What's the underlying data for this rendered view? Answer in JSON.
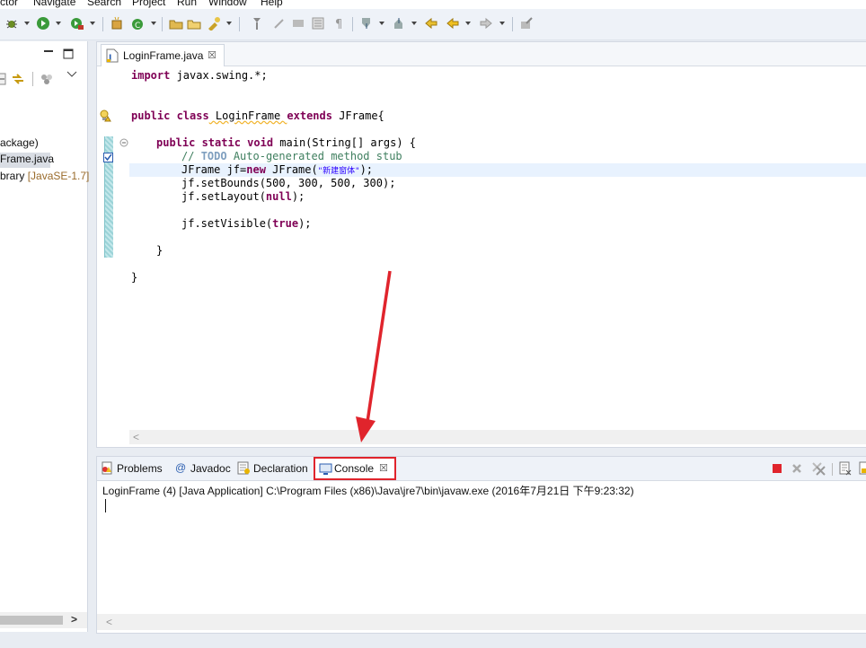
{
  "menu": {
    "items": [
      "ctor",
      "Navigate",
      "Search",
      "Project",
      "Run",
      "Window",
      "Help"
    ]
  },
  "toolbar": {
    "icons": [
      "debug-icon",
      "run-icon",
      "external-tools-icon",
      "new-java-package-icon",
      "new-java-class-icon",
      "open-type-icon",
      "open-task-icon",
      "search-icon",
      "toggle-mark-occurrences-icon",
      "show-whitespace-icon",
      "toggle-block-selection-icon",
      "next-annotation-icon",
      "previous-annotation-icon",
      "last-edit-location-icon",
      "back-icon",
      "forward-icon",
      "pin-editor-icon"
    ]
  },
  "explorer": {
    "items": [
      {
        "label": "ackage)"
      },
      {
        "label": "Frame.java"
      },
      {
        "label": "brary ",
        "decoration": "[JavaSE-1.7]"
      }
    ]
  },
  "editor": {
    "tab_label": "LoginFrame.java",
    "close_glyph": "☒",
    "code": {
      "l1_kw": "import",
      "l1_rest": " javax.swing.*;",
      "l2_kw": "public class",
      "l2_name": " LoginFrame ",
      "l2_kw2": "extends",
      "l2_rest": " JFrame{",
      "l3_kw": "public static void",
      "l3_rest": " main(String[] args) {",
      "l4_comment": "// ",
      "l4_todo": "TODO",
      "l4_rest": " Auto-generated method stub",
      "l5_a": "JFrame jf=",
      "l5_kw": "new",
      "l5_b": " JFrame(",
      "l5_str": "\"新建窗体\"",
      "l5_c": ");",
      "l6": "jf.setBounds(500, 300, 500, 300);",
      "l7_a": "jf.setLayout(",
      "l7_kw": "null",
      "l7_b": ");",
      "l8_a": "jf.setVisible(",
      "l8_kw": "true",
      "l8_b": ");",
      "l9": "}",
      "l10": "}"
    }
  },
  "bottom_tabs": {
    "problems": "Problems",
    "javadoc": "Javadoc",
    "declaration": "Declaration",
    "console": "Console",
    "at_glyph": "@",
    "close_glyph": "☒"
  },
  "console": {
    "header": "LoginFrame (4) [Java Application] C:\\Program Files (x86)\\Java\\jre7\\bin\\javaw.exe (2016年7月21日 下午9:23:32)"
  },
  "scroll": {
    "left_arrow": "<",
    "right_arrow": ">"
  },
  "colors": {
    "annotation_red": "#e0242c",
    "keyword": "#7f0055",
    "comment": "#3f7f5f",
    "string": "#2a00ff"
  }
}
